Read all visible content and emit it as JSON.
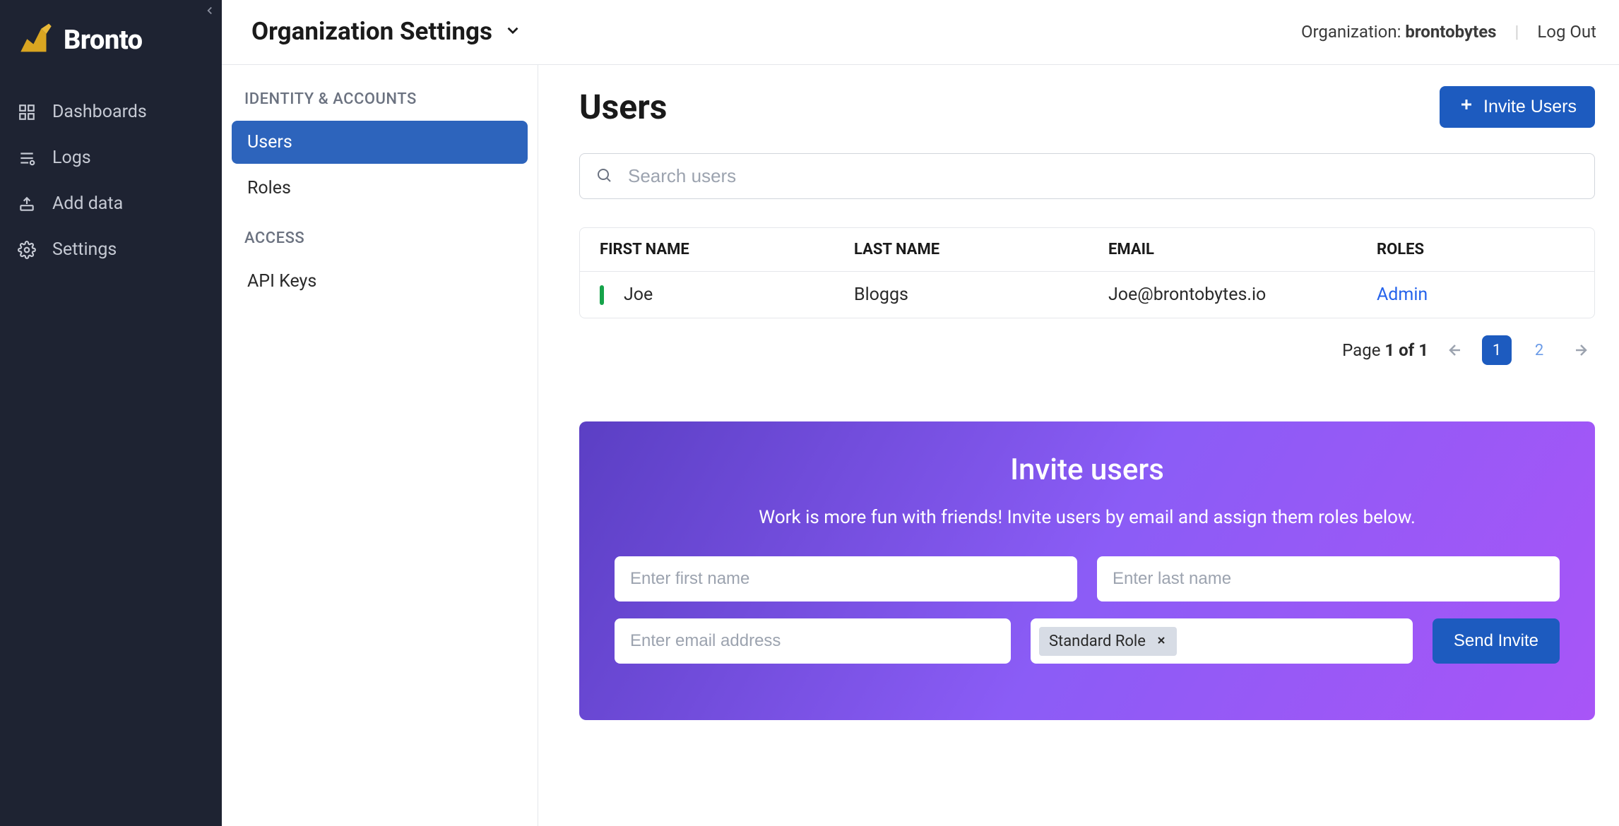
{
  "brand": {
    "name": "Bronto"
  },
  "sidebar": {
    "items": [
      {
        "label": "Dashboards"
      },
      {
        "label": "Logs"
      },
      {
        "label": "Add data"
      },
      {
        "label": "Settings"
      }
    ]
  },
  "header": {
    "title": "Organization Settings",
    "org_label": "Organization: ",
    "org_name": "brontobytes",
    "logout": "Log Out"
  },
  "settings_nav": {
    "group1_label": "IDENTITY & ACCOUNTS",
    "users": "Users",
    "roles": "Roles",
    "group2_label": "ACCESS",
    "api_keys": "API Keys"
  },
  "content": {
    "title": "Users",
    "invite_button": "Invite Users",
    "search_placeholder": "Search users"
  },
  "table": {
    "headers": {
      "first": "FIRST NAME",
      "last": "LAST NAME",
      "email": "EMAIL",
      "roles": "ROLES"
    },
    "rows": [
      {
        "first": "Joe",
        "last": "Bloggs",
        "email": "Joe@brontobytes.io",
        "role": "Admin"
      }
    ]
  },
  "pagination": {
    "label_prefix": "Page ",
    "current_of": "1 of 1",
    "pages": {
      "p1": "1",
      "p2": "2"
    }
  },
  "invite": {
    "title": "Invite users",
    "subtitle": "Work is more fun with friends! Invite users by email and assign them roles below.",
    "first_ph": "Enter first name",
    "last_ph": "Enter last name",
    "email_ph": "Enter email address",
    "role_chip": "Standard Role",
    "send": "Send Invite"
  }
}
